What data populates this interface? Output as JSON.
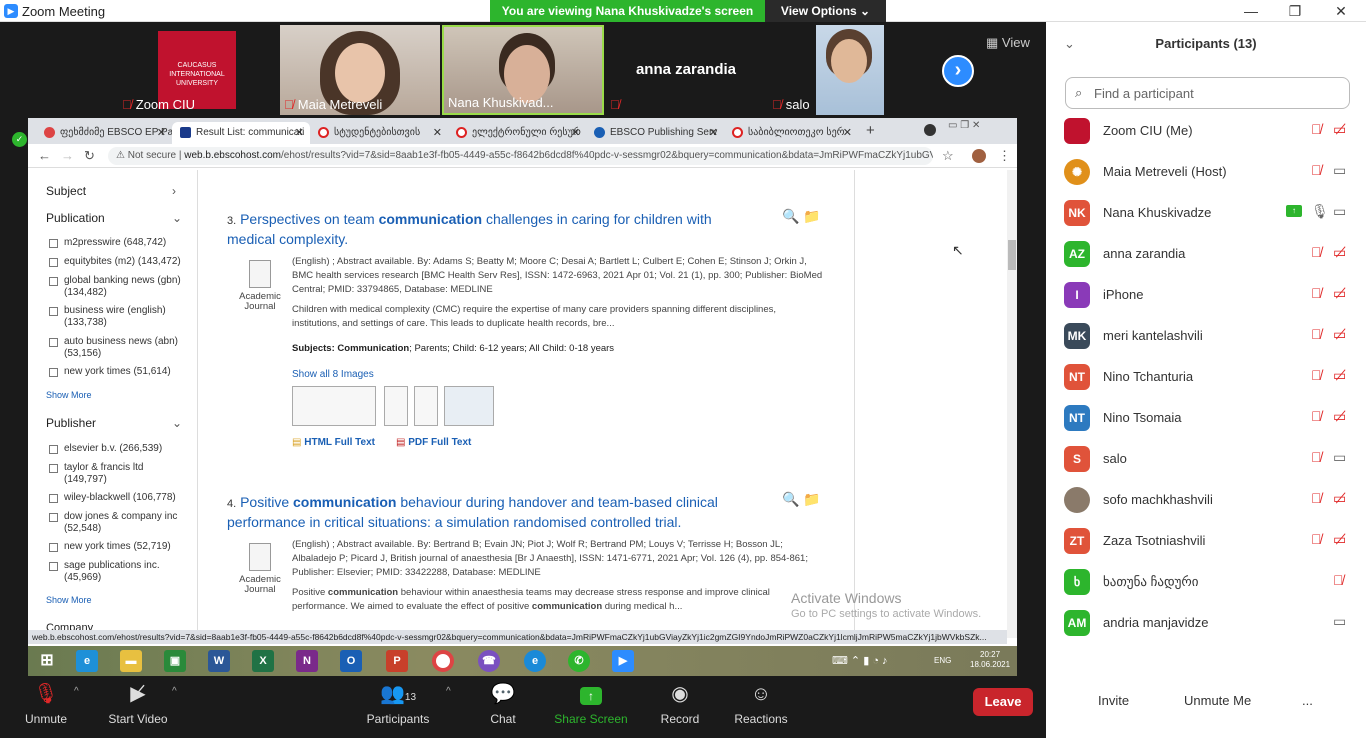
{
  "window": {
    "title": "Zoom Meeting",
    "minimize": "—",
    "maximize": "❐",
    "close": "✕"
  },
  "banner": {
    "viewing": "You are viewing Nana Khuskivadze's screen",
    "view_options": "View Options ⌄"
  },
  "videos": {
    "tiles": [
      {
        "name": "Zoom CIU"
      },
      {
        "name": "Maia Metreveli"
      },
      {
        "name": "Nana Khuskivad..."
      },
      {
        "name": "anna zarandia"
      },
      {
        "name": "salo"
      }
    ],
    "view_label": "View"
  },
  "browser": {
    "tabs": [
      "ფეხმძიმე EBSCO EP Pac...",
      "Result List: communicati",
      "სტუდენტებისთვის",
      "ელექტრონული რესურ",
      "EBSCO Publishing Serv",
      "საბიბლიოთეკო სერ"
    ],
    "not_secure": "Not secure",
    "url_domain": "web.b.ebscohost.com",
    "url_path": "/ehost/results?vid=7&sid=8aab1e3f-fb05-4449-a55c-f8642b6dcd8f%40pdc-v-sessmgr02&bquery=communication&bdata=JmRiPWFmaCZkYj1ubGViayZkYj1ic2gmZGI9YndoJmRiPWZ0aCZkYj",
    "status_url": "web.b.ebscohost.com/ehost/results?vid=7&sid=8aab1e3f-fb05-4449-a55c-f8642b6dcd8f%40pdc-v-sessmgr02&bquery=communication&bdata=JmRiPWFmaCZkYj1ubGViayZkYj1ic2gmZGI9YndoJmRiPWZ0aCZkYj1lcmljJmRiPW5maCZkYj1jbWVkbSZk..."
  },
  "sidebar": {
    "subject": "Subject",
    "publication": "Publication",
    "publications": [
      "m2presswire (648,742)",
      "equitybites (m2) (143,472)",
      "global banking news (gbn) (134,482)",
      "business wire (english) (133,738)",
      "auto business news (abn) (53,156)",
      "new york times (51,614)"
    ],
    "show_more": "Show More",
    "publisher": "Publisher",
    "publishers": [
      "elsevier b.v. (266,539)",
      "taylor & francis ltd (149,797)",
      "wiley-blackwell (106,778)",
      "dow jones & company inc (52,548)",
      "new york times (52,719)",
      "sage publications inc. (45,969)"
    ],
    "company": "Company"
  },
  "results": [
    {
      "num": "3.",
      "title_pre": "Perspectives on team ",
      "title_kw": "communication",
      "title_post": " challenges in caring for children with medical complexity.",
      "type_line1": "Academic",
      "type_line2": "Journal",
      "meta": "(English) ; Abstract available. By: Adams S; Beatty M; Moore C; Desai A; Bartlett L; Culbert E; Cohen E; Stinson J; Orkin J, BMC health services research [BMC Health Serv Res], ISSN: 1472-6963, 2021 Apr 01; Vol. 21 (1), pp. 300; Publisher: BioMed Central; PMID: 33794865, Database: MEDLINE",
      "abstract": "Children with medical complexity (CMC) require the expertise of many care providers spanning different disciplines, institutions, and settings of care. This leads to duplicate health records, bre...",
      "subjects_label": "Subjects:",
      "subjects_kw": "Communication",
      "subjects_rest": "; Parents; Child: 6-12 years; All Child: 0-18 years",
      "show_images": "Show all 8 Images",
      "html_full": "HTML Full Text",
      "pdf_full": "PDF Full Text"
    },
    {
      "num": "4.",
      "title_pre": "Positive ",
      "title_kw": "communication",
      "title_post": " behaviour during handover and team-based clinical performance in critical situations: a simulation randomised controlled trial.",
      "type_line1": "Academic",
      "type_line2": "Journal",
      "meta": "(English) ; Abstract available. By: Bertrand B; Evain JN; Piot J; Wolf R; Bertrand PM; Louys V; Terrisse H; Bosson JL; Albaladejo P; Picard J, British journal of anaesthesia [Br J Anaesth], ISSN: 1471-6771, 2021 Apr; Vol. 126 (4), pp. 854-861; Publisher: Elsevier; PMID: 33422288, Database: MEDLINE",
      "abstract_pre": "Positive ",
      "abstract_kw1": "communication",
      "abstract_mid": " behaviour within anaesthesia teams may decrease stress response and improve clinical performance. We aimed to evaluate the effect of positive ",
      "abstract_kw2": "communication",
      "abstract_post": " during medical h..."
    }
  ],
  "watermark": {
    "line1": "Activate Windows",
    "line2": "Go to PC settings to activate Windows."
  },
  "taskbar": {
    "lang": "ENG",
    "time": "20:27",
    "date": "18.06.2021"
  },
  "toolbar": {
    "unmute": "Unmute",
    "start_video": "Start Video",
    "participants": "Participants",
    "participants_count": "13",
    "chat": "Chat",
    "share_screen": "Share Screen",
    "record": "Record",
    "reactions": "Reactions",
    "leave": "Leave"
  },
  "panel": {
    "title": "Participants (13)",
    "search_placeholder": "Find a participant",
    "participants": [
      {
        "initials": "",
        "name": "Zoom CIU (Me)",
        "color": "#c0122e"
      },
      {
        "initials": "",
        "name": "Maia Metreveli (Host)",
        "color": "#e0901a"
      },
      {
        "initials": "NK",
        "name": "Nana Khuskivadze",
        "color": "#e0533a"
      },
      {
        "initials": "AZ",
        "name": "anna zarandia",
        "color": "#2db52d"
      },
      {
        "initials": "I",
        "name": "iPhone",
        "color": "#8a3ab8"
      },
      {
        "initials": "MK",
        "name": "meri kantelashvili",
        "color": "#3a4a5a"
      },
      {
        "initials": "NT",
        "name": "Nino Tchanturia",
        "color": "#e0533a"
      },
      {
        "initials": "NT",
        "name": "Nino Tsomaia",
        "color": "#2d7ac0"
      },
      {
        "initials": "S",
        "name": "salo",
        "color": "#e0533a"
      },
      {
        "initials": "",
        "name": "sofo machkhashvili",
        "color": "#8a7a6a"
      },
      {
        "initials": "ZT",
        "name": "Zaza Tsotniashvili",
        "color": "#e0533a"
      },
      {
        "initials": "ხ",
        "name": "ხათუნა ჩადური",
        "color": "#2db52d"
      },
      {
        "initials": "AM",
        "name": "andria manjavidze",
        "color": "#2db52d"
      }
    ],
    "invite": "Invite",
    "unmute_me": "Unmute Me",
    "more": "..."
  }
}
